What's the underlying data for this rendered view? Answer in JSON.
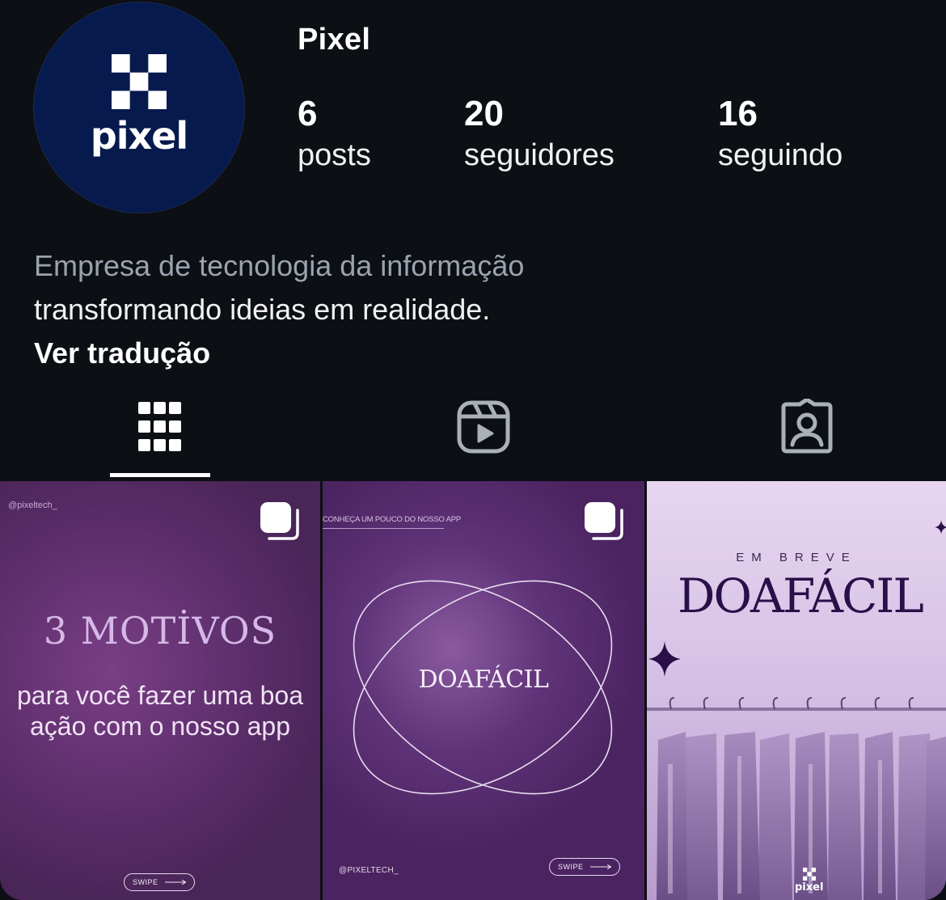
{
  "profile": {
    "username": "Pixel",
    "avatar_text": "pixel",
    "avatar_color": "#071a4e",
    "stats": {
      "posts_count": "6",
      "posts_label": "posts",
      "followers_count": "20",
      "followers_label": "seguidores",
      "following_count": "16",
      "following_label": "seguindo"
    },
    "bio": {
      "line1": "Empresa de tecnologia da informação",
      "line2": "transformando ideias em realidade.",
      "translate_label": "Ver tradução"
    }
  },
  "tabs": [
    {
      "icon": "grid-icon",
      "active": true
    },
    {
      "icon": "reels-icon",
      "active": false
    },
    {
      "icon": "tagged-icon",
      "active": false
    }
  ],
  "posts": [
    {
      "type": "carousel",
      "handle": "@pixeltech_",
      "title": "3 MOTİVOS",
      "body": "para você fazer uma boa ação com o nosso app",
      "swipe_label": "SWIPE"
    },
    {
      "type": "carousel",
      "caption": "CONHEÇA UM POUCO DO NOSSO APP",
      "title": "DOAFÁCIL",
      "handle": "@PIXELTECH_",
      "swipe_label": "SWIPE"
    },
    {
      "type": "image",
      "kicker": "EM BREVE",
      "title": "DOAFÁCIL",
      "logo_text": "pixel"
    }
  ],
  "colors": {
    "background": "#0c0f14",
    "bio_secondary": "#9aa3ae",
    "accent_purple": "#5e2f6d"
  }
}
